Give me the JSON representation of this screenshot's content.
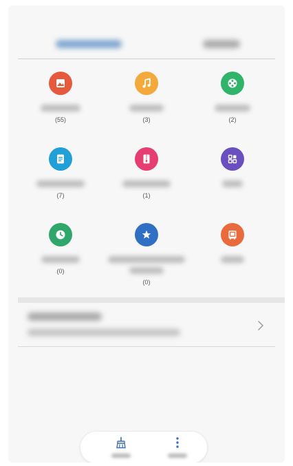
{
  "tabs": [
    {
      "label": ""
    },
    {
      "label": ""
    }
  ],
  "categories": [
    {
      "icon": "image-icon",
      "color": "#e55a3c",
      "count": "(55)"
    },
    {
      "icon": "music-icon",
      "color": "#f3a93b",
      "count": "(3)"
    },
    {
      "icon": "video-icon",
      "color": "#2fb46a",
      "count": "(2)"
    },
    {
      "icon": "document-icon",
      "color": "#21a0d8",
      "count": "(7)"
    },
    {
      "icon": "archive-icon",
      "color": "#e63e72",
      "count": "(1)"
    },
    {
      "icon": "apps-icon",
      "color": "#6a4fc0",
      "count": ""
    },
    {
      "icon": "recent-clock-icon",
      "color": "#2fa66a",
      "count": "(0)"
    },
    {
      "icon": "favorites-star-icon",
      "color": "#2f6fc4",
      "count": "(0)"
    },
    {
      "icon": "safe-icon",
      "color": "#e96a3d",
      "count": ""
    }
  ],
  "storage": {
    "chevron": "chevron-right-icon"
  },
  "bottom_bar": [
    {
      "icon": "broom-clean-icon"
    },
    {
      "icon": "more-vertical-icon"
    }
  ]
}
